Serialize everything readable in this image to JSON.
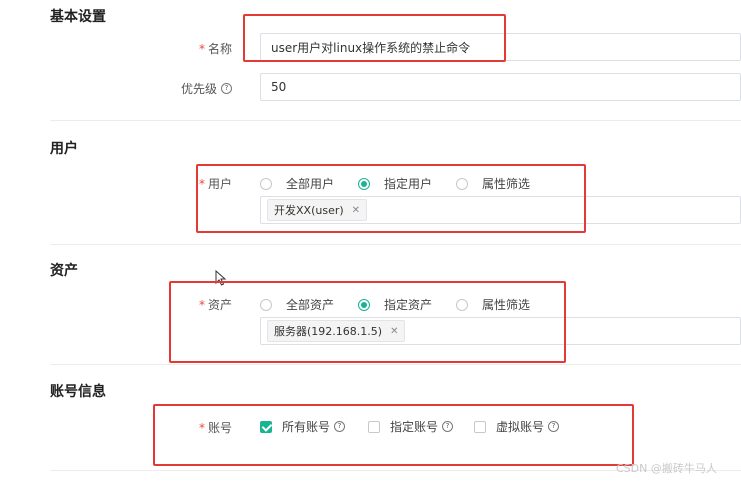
{
  "basic": {
    "title": "基本设置",
    "name_label": "名称",
    "name_value": "user用户对linux操作系统的禁止命令",
    "priority_label": "优先级",
    "priority_value": "50"
  },
  "users": {
    "title": "用户",
    "field_label": "用户",
    "options": [
      "全部用户",
      "指定用户",
      "属性筛选"
    ],
    "selected": "指定用户",
    "tags": [
      "开发XX(user)"
    ]
  },
  "assets": {
    "title": "资产",
    "field_label": "资产",
    "options": [
      "全部资产",
      "指定资产",
      "属性筛选"
    ],
    "selected": "指定资产",
    "tags": [
      "服务器(192.168.1.5)"
    ]
  },
  "accounts": {
    "title": "账号信息",
    "field_label": "账号",
    "options": [
      "所有账号",
      "指定账号",
      "虚拟账号"
    ],
    "checked": [
      "所有账号"
    ]
  },
  "watermark": "CSDN @搬砖牛马人",
  "accent_color": "#1ab394",
  "annotation_color": "#e53935",
  "icons": {
    "help": "question-circle-icon",
    "close": "close-icon",
    "cursor": "mouse-cursor-icon"
  }
}
